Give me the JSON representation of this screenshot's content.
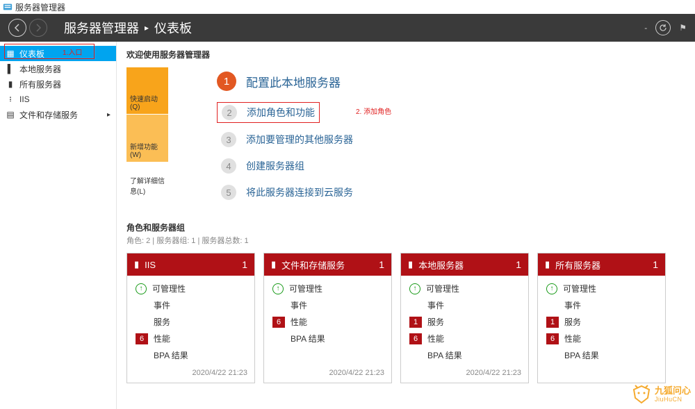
{
  "window_title": "服务器管理器",
  "breadcrumb": {
    "root": "服务器管理器",
    "sep": "▸",
    "current": "仪表板"
  },
  "sidebar": {
    "items": [
      {
        "label": "仪表板"
      },
      {
        "label": "本地服务器"
      },
      {
        "label": "所有服务器"
      },
      {
        "label": "IIS"
      },
      {
        "label": "文件和存储服务"
      }
    ],
    "annotation": "1.入口"
  },
  "welcome": "欢迎使用服务器管理器",
  "quickstart": {
    "tabs": {
      "quick": "快速启动(Q)",
      "new": "新增功能(W)",
      "learn": "了解详细信息(L)"
    },
    "title_num": "1",
    "title": "配置此本地服务器",
    "steps": [
      {
        "num": "2",
        "label": "添加角色和功能"
      },
      {
        "num": "3",
        "label": "添加要管理的其他服务器"
      },
      {
        "num": "4",
        "label": "创建服务器组"
      },
      {
        "num": "5",
        "label": "将此服务器连接到云服务"
      }
    ],
    "annotation": "2. 添加角色"
  },
  "roles": {
    "header": "角色和服务器组",
    "sub": "角色: 2 | 服务器组: 1 | 服务器总数: 1"
  },
  "tiles": [
    {
      "title": "IIS",
      "count": "1",
      "rows": [
        {
          "badge_type": "up",
          "badge": "↑",
          "label": "可管理性"
        },
        {
          "badge_type": "none",
          "label": "事件"
        },
        {
          "badge_type": "none",
          "label": "服务"
        },
        {
          "badge_type": "red",
          "badge": "6",
          "label": "性能"
        },
        {
          "badge_type": "none",
          "label": "BPA 结果"
        }
      ],
      "timestamp": "2020/4/22 21:23"
    },
    {
      "title": "文件和存储服务",
      "count": "1",
      "rows": [
        {
          "badge_type": "up",
          "badge": "↑",
          "label": "可管理性"
        },
        {
          "badge_type": "none",
          "label": "事件"
        },
        {
          "badge_type": "red",
          "badge": "6",
          "label": "性能"
        },
        {
          "badge_type": "none",
          "label": "BPA 结果"
        }
      ],
      "timestamp": "2020/4/22 21:23"
    },
    {
      "title": "本地服务器",
      "count": "1",
      "rows": [
        {
          "badge_type": "up",
          "badge": "↑",
          "label": "可管理性"
        },
        {
          "badge_type": "none",
          "label": "事件"
        },
        {
          "badge_type": "red",
          "badge": "1",
          "label": "服务"
        },
        {
          "badge_type": "red",
          "badge": "6",
          "label": "性能"
        },
        {
          "badge_type": "none",
          "label": "BPA 结果"
        }
      ],
      "timestamp": "2020/4/22 21:23"
    },
    {
      "title": "所有服务器",
      "count": "1",
      "rows": [
        {
          "badge_type": "up",
          "badge": "↑",
          "label": "可管理性"
        },
        {
          "badge_type": "none",
          "label": "事件"
        },
        {
          "badge_type": "red",
          "badge": "1",
          "label": "服务"
        },
        {
          "badge_type": "red",
          "badge": "6",
          "label": "性能"
        },
        {
          "badge_type": "none",
          "label": "BPA 结果"
        }
      ],
      "timestamp": ""
    }
  ],
  "watermark": {
    "main": "九狐问心",
    "sub": "JiuHuCN"
  }
}
